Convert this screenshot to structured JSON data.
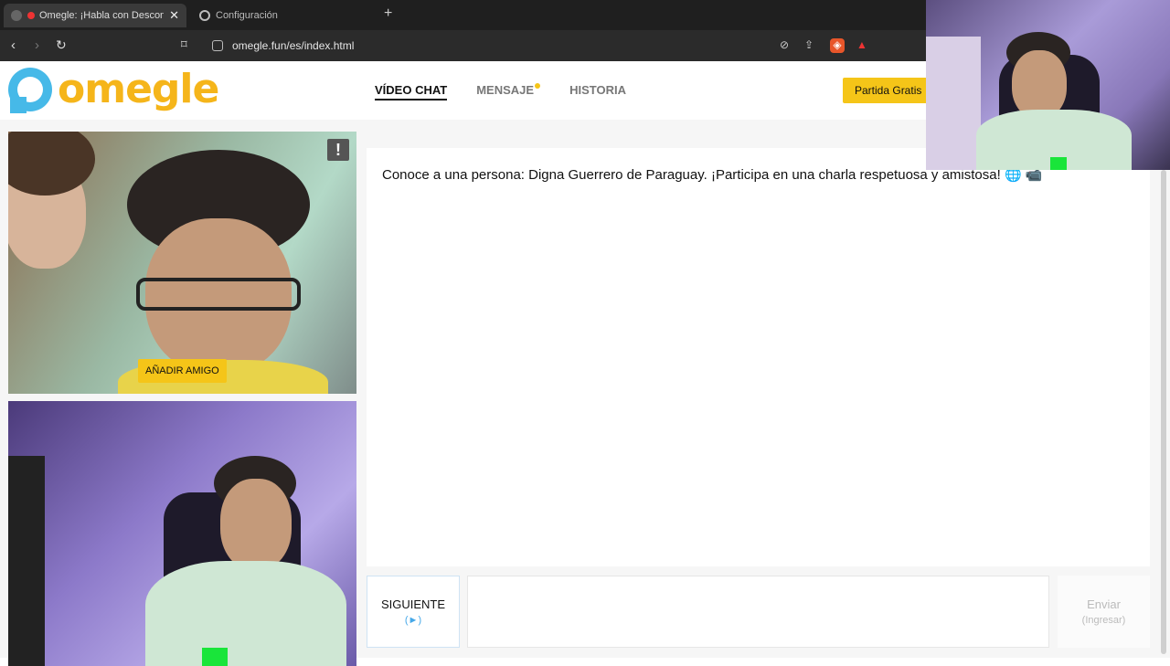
{
  "browser": {
    "tabs": [
      {
        "title": "Omegle: ¡Habla con Descono",
        "active": true
      },
      {
        "title": "Configuración",
        "active": false
      }
    ],
    "url": "omegle.fun/es/index.html"
  },
  "site": {
    "logo_text": "omegle",
    "nav": [
      "VÍDEO CHAT",
      "MENSAJE",
      "HISTORIA"
    ],
    "cta": "Partida Gratis"
  },
  "video": {
    "add_friend": "AÑADIR AMIGO",
    "report": "!"
  },
  "chat": {
    "message": "Conoce a una persona: Digna Guerrero de Paraguay. ¡Participa en una charla respetuosa y amistosa! 🌐 📹"
  },
  "controls": {
    "next_label": "SIGUIENTE",
    "next_hint": "(►)",
    "send_label": "Enviar",
    "send_hint": "(Ingresar)"
  },
  "colors": {
    "brand_yellow": "#f5c518",
    "brand_blue": "#46b9e8"
  }
}
